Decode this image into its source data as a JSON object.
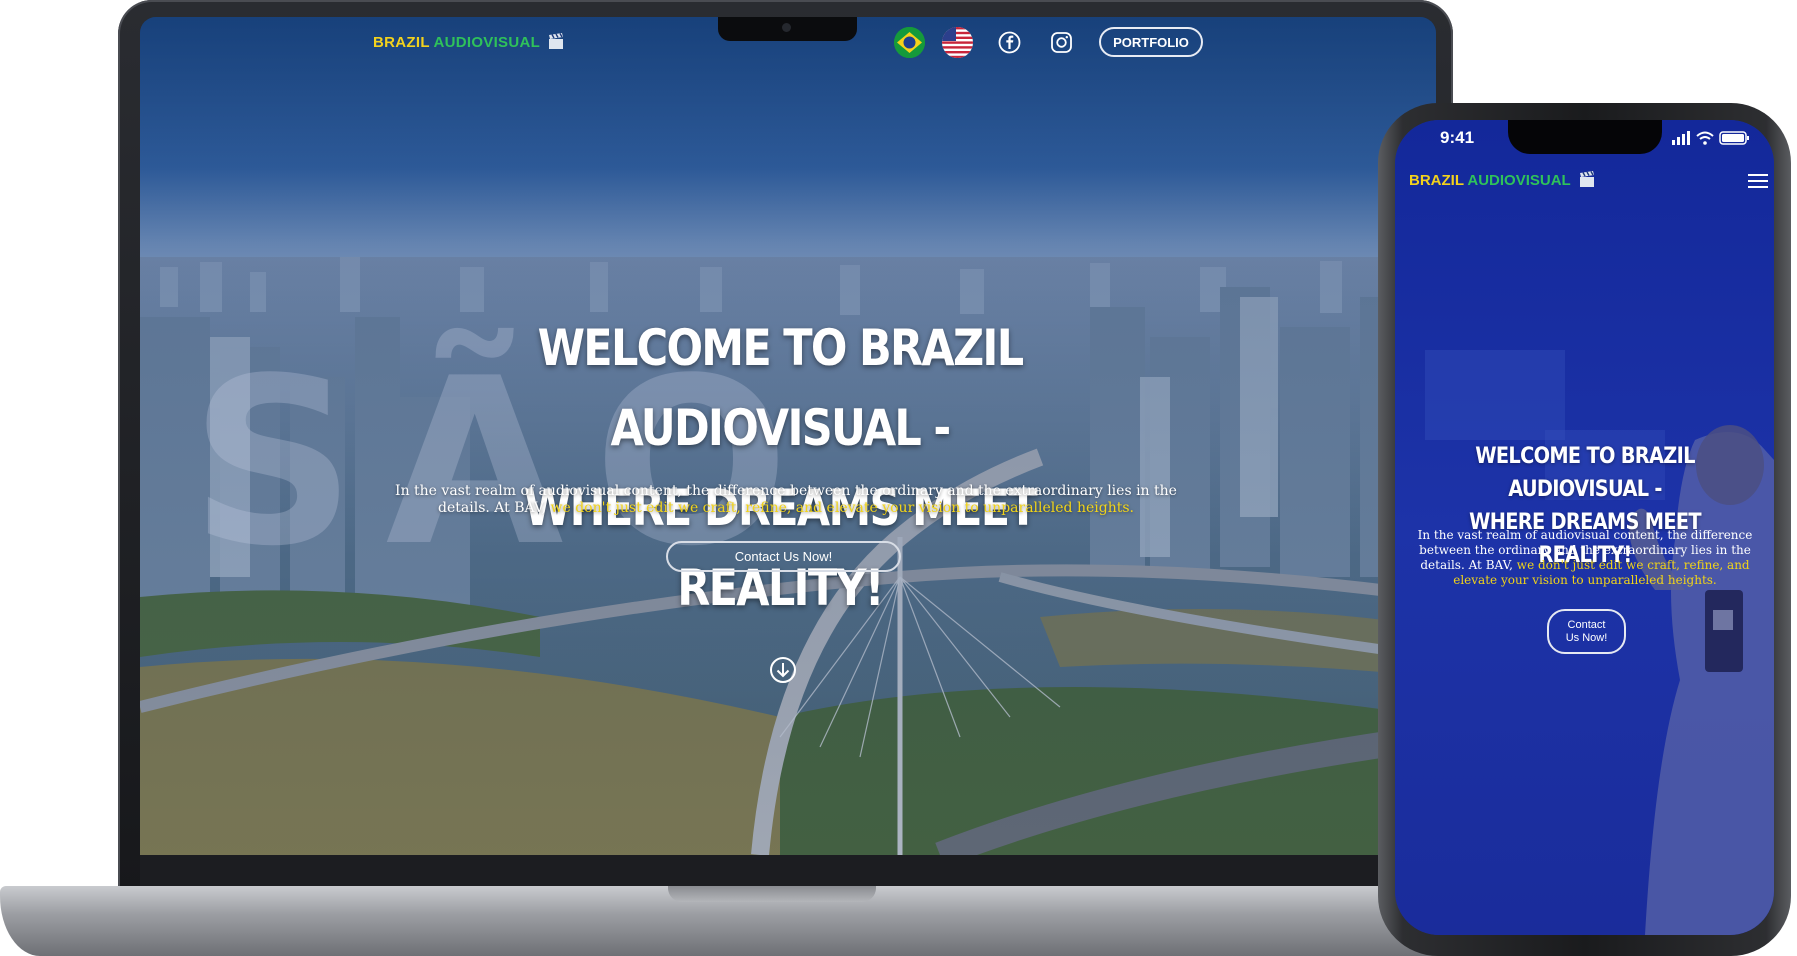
{
  "brand": {
    "part1": "BRAZIL",
    "part2": "AUDIOVISUAL"
  },
  "nav": {
    "portfolio_label": "PORTFOLIO",
    "languages": [
      "pt-BR flag",
      "en-US flag"
    ],
    "social": [
      "facebook-icon",
      "instagram-icon"
    ]
  },
  "hero": {
    "title_line1": "WELCOME TO BRAZIL AUDIOVISUAL -",
    "title_line2": "WHERE DREAMS MEET REALITY!",
    "text_plain": "In the vast realm of audiovisual content, the difference between the ordinary and the extraordinary lies in the details. At BAV,",
    "text_highlight": "we don't just edit we craft, refine, and elevate your vision to unparalleled heights.",
    "cta_label": "Contact Us Now!"
  },
  "watermark": "SÃO",
  "phone": {
    "status_time": "9:41",
    "cta_label_line1": "Contact",
    "cta_label_line2": "Us Now!"
  },
  "colors": {
    "brand_yellow": "#f3d21c",
    "brand_green": "#2fc25a",
    "overlay_blue": "#1a2fa5",
    "highlight_yellow": "#f2d418"
  }
}
